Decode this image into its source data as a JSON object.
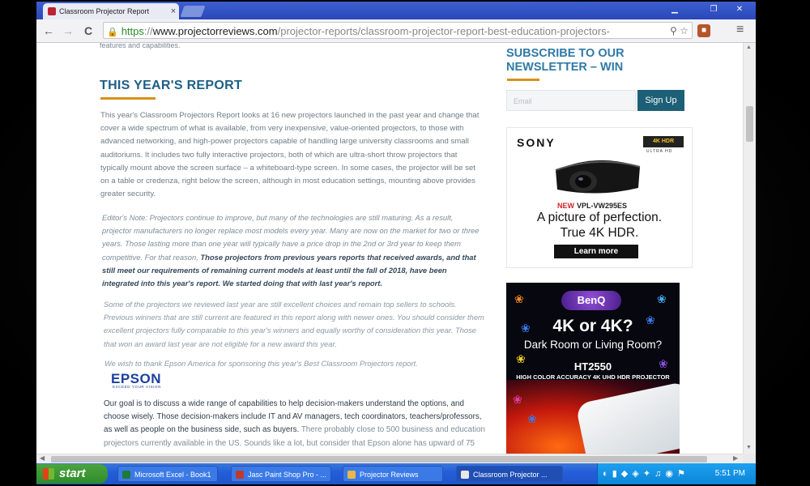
{
  "browser": {
    "tab_title": "Classroom Projector Report",
    "tab_close": "×",
    "window_controls": [
      "▁",
      "❐",
      "✕"
    ],
    "back": "←",
    "forward": "→",
    "reload": "C",
    "url_scheme": "https",
    "url_sep": "://",
    "url_host": "www.projectorreviews.com",
    "url_path": "/projector-reports/classroom-projector-report-best-education-projectors-",
    "menu_glyph": "≡"
  },
  "article": {
    "top_fragment": "features and capabilities.",
    "heading": "THIS YEAR'S REPORT",
    "paragraph1": "This year's Classroom Projectors Report looks at 16 new projectors launched in the past year and change that cover a wide spectrum of what is available, from very inexpensive, value-oriented projectors, to those with advanced networking, and high-power projectors capable of handling large university classrooms and small auditoriums. It includes two fully interactive projectors, both of which are ultra-short throw projectors that typically mount above the screen surface – a whiteboard-type screen. In some cases, the projector will be set on a table or credenza, right below the screen, although in most education settings, mounting above provides greater security.",
    "editors_note": "Editor's Note: Projectors continue to improve, but many of the technologies are still maturing. As a result, projector manufacturers no longer replace most models every year. Many are now on the market for two or three years. Those lasting more than one year will typically have a price drop in the 2nd or 3rd year to keep them competitive. For that reason,",
    "editors_note_bold": "Those projectors from previous years reports that received awards, and that still meet our requirements of remaining current models at least until the fall of 2018, have been integrated into this year's report. We started doing that with last year's report.",
    "paragraph3": "Some of the projectors we reviewed last year are still excellent choices and remain top sellers to schools. Previous winners that are still current are featured in this report along with newer ones. You should consider them excellent projectors fully comparable to this year's winners and equally worthy of consideration this year. Those that won an award last year are not eligible for a new award this year.",
    "sponsor_note": "We wish to thank Epson America for sponsoring this year's Best Classroom Projectors report.",
    "sponsor_logo": "EPSON",
    "sponsor_tagline": "EXCEED YOUR VISION",
    "goal_text": "Our goal is to discuss a wide range of capabilities to help decision-makers understand the options, and choose wisely. Those decision-makers include IT and AV managers, tech coordinators, teachers/professors, as well as people on the business side, such as buyers.",
    "goal_text_light": "There probably close to 500 business and education projectors currently available in the US. Sounds like a lot, but consider that Epson alone has upward of 75"
  },
  "sidebar": {
    "newsletter_title": "SUBSCRIBE TO OUR NEWSLETTER – WIN",
    "email_placeholder": "Email",
    "signup_label": "Sign Up",
    "sony_ad": {
      "brand": "SONY",
      "badge": "4K HDR",
      "badge_sub": "ULTRA HD",
      "new_label": "NEW",
      "model": "VPL-VW295ES",
      "tagline1": "A picture of perfection.",
      "tagline2": "True 4K HDR.",
      "cta": "Learn more"
    },
    "benq_ad": {
      "brand": "BenQ",
      "headline": "4K or 4K?",
      "subhead": "Dark Room or Living Room?",
      "model": "HT2550",
      "subtitle": "HIGH COLOR ACCURACY 4K UHD HDR PROJECTOR"
    }
  },
  "taskbar": {
    "start_label": "start",
    "tasks": [
      {
        "label": "Microsoft Excel - Book1",
        "color": "#1e7a3a"
      },
      {
        "label": "Jasc Paint Shop Pro - ...",
        "color": "#c0392b"
      },
      {
        "label": "Projector Reviews",
        "color": "#e8b84a"
      },
      {
        "label": "Classroom Projector ...",
        "color": "#e8e8e8"
      }
    ],
    "tray_icons": "◐ ▮ ◆ ◈ ✦ ♫ ◉ ⚑",
    "clock": "5:51 PM"
  }
}
